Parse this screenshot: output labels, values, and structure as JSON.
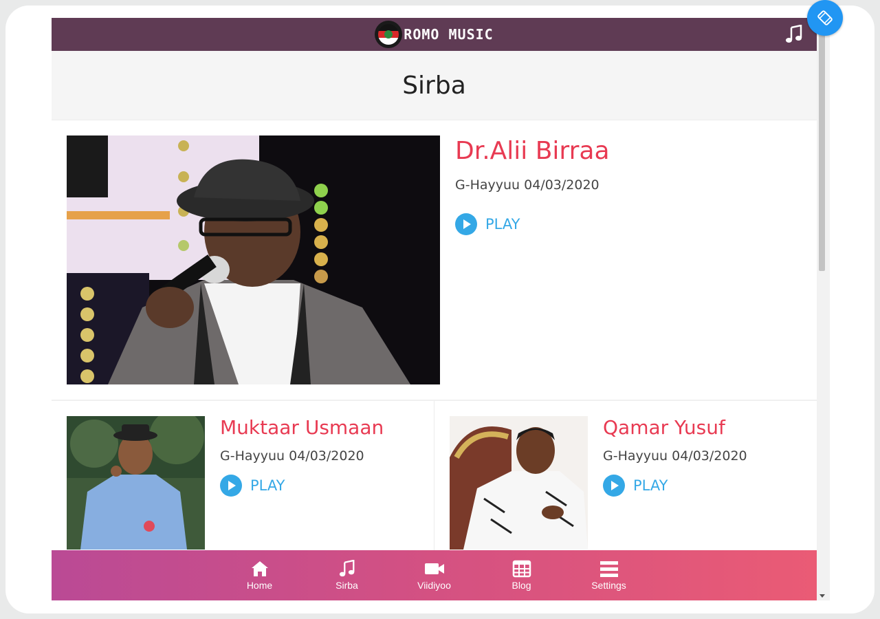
{
  "app": {
    "logo_text": "ROMO MUSIC",
    "page_title": "Sirba"
  },
  "featured": {
    "artist": "Dr.Alii Birraa",
    "date": "G-Hayyuu 04/03/2020",
    "play_label": "PLAY"
  },
  "tracks": [
    {
      "artist": "Muktaar Usmaan",
      "date": "G-Hayyuu 04/03/2020",
      "play_label": "PLAY"
    },
    {
      "artist": "Qamar Yusuf",
      "date": "G-Hayyuu 04/03/2020",
      "play_label": "PLAY"
    }
  ],
  "nav": {
    "items": [
      {
        "label": "Home",
        "icon": "home-icon"
      },
      {
        "label": "Sirba",
        "icon": "music-note-icon"
      },
      {
        "label": "Viidiyoo",
        "icon": "video-camera-icon"
      },
      {
        "label": "Blog",
        "icon": "calendar-grid-icon"
      },
      {
        "label": "Settings",
        "icon": "menu-bars-icon"
      }
    ]
  },
  "colors": {
    "topbar": "#5f3b54",
    "accent_name": "#e83a52",
    "play_blue": "#34a8e6",
    "nav_gradient_start": "#ba4a95",
    "nav_gradient_end": "#ea5b75"
  }
}
